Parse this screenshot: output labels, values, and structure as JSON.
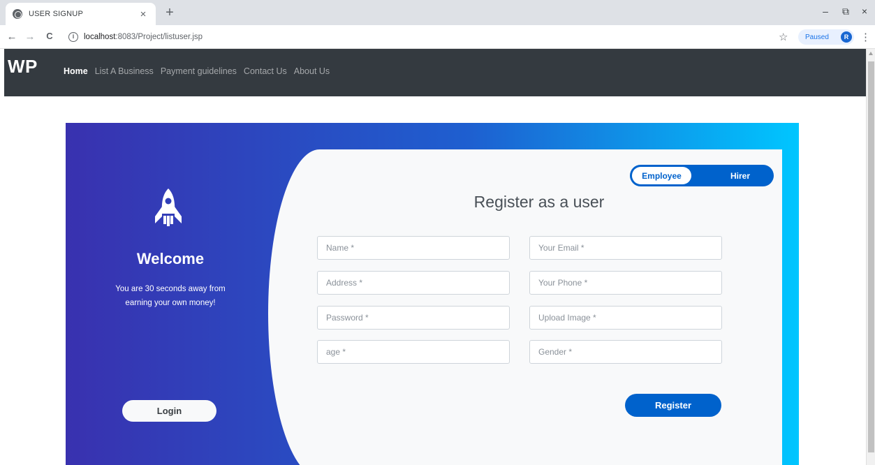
{
  "browser": {
    "tab_title": "USER SIGNUP",
    "tab_close": "×",
    "new_tab": "+",
    "back": "←",
    "forward": "→",
    "reload": "C",
    "url_host": "localhost",
    "url_rest": ":8083/Project/listuser.jsp",
    "profile_status": "Paused",
    "profile_initial": "R",
    "minimize": "–",
    "restore": "⧉",
    "close": "×",
    "menu": "⋮",
    "bookmark": "☆"
  },
  "navbar": {
    "brand": "WP",
    "links": [
      "Home",
      "List A Business",
      "Payment guidelines",
      "Contact Us",
      "About Us"
    ],
    "active_link": "Home"
  },
  "left_panel": {
    "icon": "rocket-icon",
    "title": "Welcome",
    "tagline": "You are 30 seconds away from earning your own money!",
    "login_label": "Login"
  },
  "form": {
    "heading": "Register as a user",
    "toggle": {
      "options": [
        "Employee",
        "Hirer"
      ],
      "selected": "Employee"
    },
    "fields": {
      "name": "Name *",
      "email": "Your Email *",
      "address": "Address *",
      "phone": "Your Phone *",
      "password": "Password *",
      "upload_image": "Upload Image *",
      "age": "age *",
      "gender": "Gender *"
    },
    "register_label": "Register"
  },
  "colors": {
    "navbar_bg": "#343a40",
    "gradient_start": "#3931af",
    "gradient_end": "#00c6ff",
    "primary": "#0062cc",
    "panel_bg": "#f8f9fa"
  }
}
